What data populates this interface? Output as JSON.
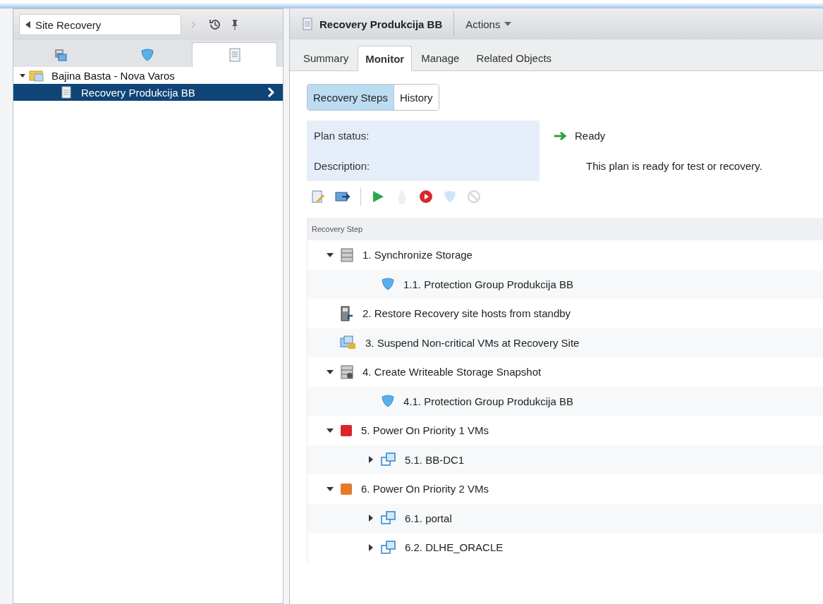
{
  "navigator": {
    "back_label": "Site Recovery"
  },
  "sidebar_tabs": [
    {
      "kind": "sites",
      "selected": false
    },
    {
      "kind": "shield",
      "selected": false
    },
    {
      "kind": "plan",
      "selected": true
    }
  ],
  "tree": [
    {
      "label": "Bajina Basta - Nova Varos",
      "expanded": true,
      "selected": false,
      "children": [
        {
          "label": "Recovery Produkcija BB",
          "selected": true
        }
      ]
    }
  ],
  "object": {
    "title": "Recovery Produkcija BB",
    "actions_label": "Actions"
  },
  "tabs": [
    {
      "label": "Summary",
      "selected": false
    },
    {
      "label": "Monitor",
      "selected": true
    },
    {
      "label": "Manage",
      "selected": false
    },
    {
      "label": "Related Objects",
      "selected": false
    }
  ],
  "subtabs": [
    {
      "label": "Recovery Steps",
      "selected": true
    },
    {
      "label": "History",
      "selected": false
    }
  ],
  "details": [
    {
      "label": "Plan status:",
      "value": "Ready",
      "kind": "status"
    },
    {
      "label": "Description:",
      "value": "This plan is ready for test or recovery.",
      "kind": "text"
    }
  ],
  "toolbar": [
    {
      "kind": "edit",
      "disabled": false
    },
    {
      "kind": "export",
      "disabled": false
    },
    {
      "kind": "separator"
    },
    {
      "kind": "play",
      "disabled": false
    },
    {
      "kind": "drop",
      "disabled": true
    },
    {
      "kind": "record",
      "disabled": false
    },
    {
      "kind": "shield",
      "disabled": true
    },
    {
      "kind": "cancel",
      "disabled": true
    }
  ],
  "steps_table": {
    "column": "Recovery Step",
    "rows": [
      {
        "label": "1. Synchronize Storage",
        "kind": "storage",
        "expanded": true,
        "children": [
          {
            "label": "1.1. Protection Group Produkcija BB",
            "kind": "shield"
          }
        ]
      },
      {
        "label": "2. Restore Recovery site hosts from standby",
        "kind": "host"
      },
      {
        "label": "3. Suspend Non-critical VMs at Recovery Site",
        "kind": "suspend"
      },
      {
        "label": "4. Create Writeable Storage Snapshot",
        "kind": "snapshot",
        "expanded": true,
        "children": [
          {
            "label": "4.1. Protection Group Produkcija BB",
            "kind": "shield"
          }
        ]
      },
      {
        "label": "5. Power On Priority 1 VMs",
        "kind": "priority",
        "color": "#d9262b",
        "expanded": true,
        "children": [
          {
            "label": "5.1. BB-DC1",
            "kind": "vm",
            "expanded": false
          }
        ]
      },
      {
        "label": "6. Power On Priority 2 VMs",
        "kind": "priority",
        "color": "#e8782a",
        "expanded": true,
        "children": [
          {
            "label": "6.1. portal",
            "kind": "vm",
            "expanded": false
          },
          {
            "label": "6.2. DLHE_ORACLE",
            "kind": "vm",
            "expanded": false
          }
        ]
      }
    ]
  }
}
